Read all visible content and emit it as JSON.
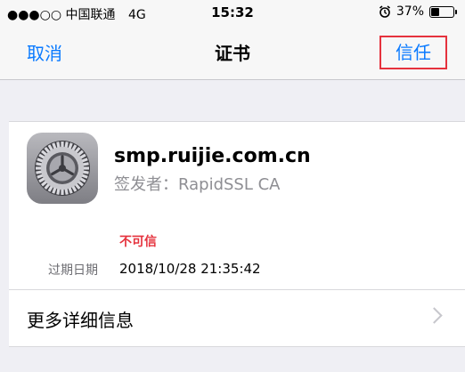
{
  "status_bar": {
    "carrier": "●●●○○ 中国联通",
    "network": "4G",
    "time": "15:32",
    "battery": "37%",
    "battery_level": 0.37
  },
  "nav": {
    "cancel": "取消",
    "title": "证书",
    "trust": "信任"
  },
  "certificate": {
    "domain": "smp.ruijie.com.cn",
    "issuer": "签发者：RapidSSL CA",
    "status": "不可信",
    "expiry_label": "过期日期",
    "expiry_value": "2018/10/28 21:35:42"
  },
  "more_details": "更多详细信息",
  "colors": {
    "accent": "#0a7aff",
    "warning": "#e5323d",
    "highlight_box": "#e5323d"
  }
}
